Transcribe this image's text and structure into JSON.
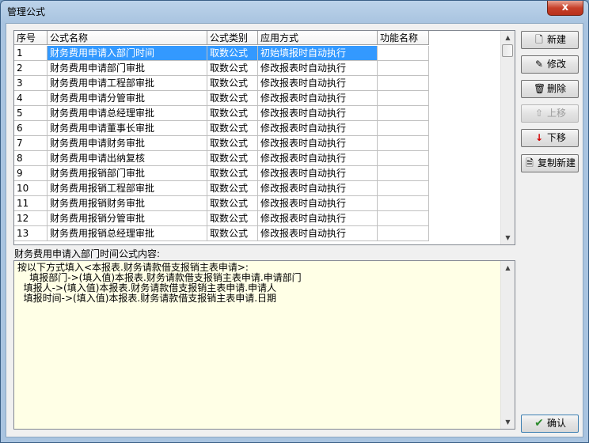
{
  "window": {
    "title": "管理公式",
    "close_label": "x"
  },
  "table": {
    "headers": [
      "序号",
      "公式名称",
      "公式类别",
      "应用方式",
      "功能名称"
    ],
    "rows": [
      {
        "no": "1",
        "name": "财务费用申请入部门时间",
        "type": "取数公式",
        "mode": "初始填报时自动执行",
        "func": ""
      },
      {
        "no": "2",
        "name": "财务费用申请部门审批",
        "type": "取数公式",
        "mode": "修改报表时自动执行",
        "func": ""
      },
      {
        "no": "3",
        "name": "财务费用申请工程部审批",
        "type": "取数公式",
        "mode": "修改报表时自动执行",
        "func": ""
      },
      {
        "no": "4",
        "name": "财务费用申请分管审批",
        "type": "取数公式",
        "mode": "修改报表时自动执行",
        "func": ""
      },
      {
        "no": "5",
        "name": "财务费用申请总经理审批",
        "type": "取数公式",
        "mode": "修改报表时自动执行",
        "func": ""
      },
      {
        "no": "6",
        "name": "财务费用申请董事长审批",
        "type": "取数公式",
        "mode": "修改报表时自动执行",
        "func": ""
      },
      {
        "no": "7",
        "name": "财务费用申请财务审批",
        "type": "取数公式",
        "mode": "修改报表时自动执行",
        "func": ""
      },
      {
        "no": "8",
        "name": "财务费用申请出纳复核",
        "type": "取数公式",
        "mode": "修改报表时自动执行",
        "func": ""
      },
      {
        "no": "9",
        "name": "财务费用报销部门审批",
        "type": "取数公式",
        "mode": "修改报表时自动执行",
        "func": ""
      },
      {
        "no": "10",
        "name": "财务费用报销工程部审批",
        "type": "取数公式",
        "mode": "修改报表时自动执行",
        "func": ""
      },
      {
        "no": "11",
        "name": "财务费用报销财务审批",
        "type": "取数公式",
        "mode": "修改报表时自动执行",
        "func": ""
      },
      {
        "no": "12",
        "name": "财务费用报销分管审批",
        "type": "取数公式",
        "mode": "修改报表时自动执行",
        "func": ""
      },
      {
        "no": "13",
        "name": "财务费用报销总经理审批",
        "type": "取数公式",
        "mode": "修改报表时自动执行",
        "func": ""
      }
    ],
    "selected_row": 1
  },
  "formula": {
    "label": "财务费用申请入部门时间公式内容:",
    "text": "按以下方式填入<本报表.财务请款借支报销主表申请>:\n    填报部门->(填入值)本报表.财务请款借支报销主表申请.申请部门\n  填报人->(填入值)本报表.财务请款借支报销主表申请.申请人\n  填报时间->(填入值)本报表.财务请款借支报销主表申请.日期"
  },
  "buttons": {
    "new": "新建",
    "edit": "修改",
    "delete": "删除",
    "up": "上移",
    "down": "下移",
    "copy_new": "复制新建",
    "ok": "确认"
  },
  "icons": {
    "new": "new-document-icon",
    "edit": "edit-icon",
    "delete": "trash-icon",
    "up": "arrow-up-icon",
    "down": "arrow-down-icon",
    "copy_new": "copy-document-icon",
    "ok": "check-icon"
  },
  "colors": {
    "selection": "#3399ff",
    "formula_bg": "#ffffe6",
    "down_arrow": "#d40000",
    "ok_check": "#2e8b2e"
  }
}
